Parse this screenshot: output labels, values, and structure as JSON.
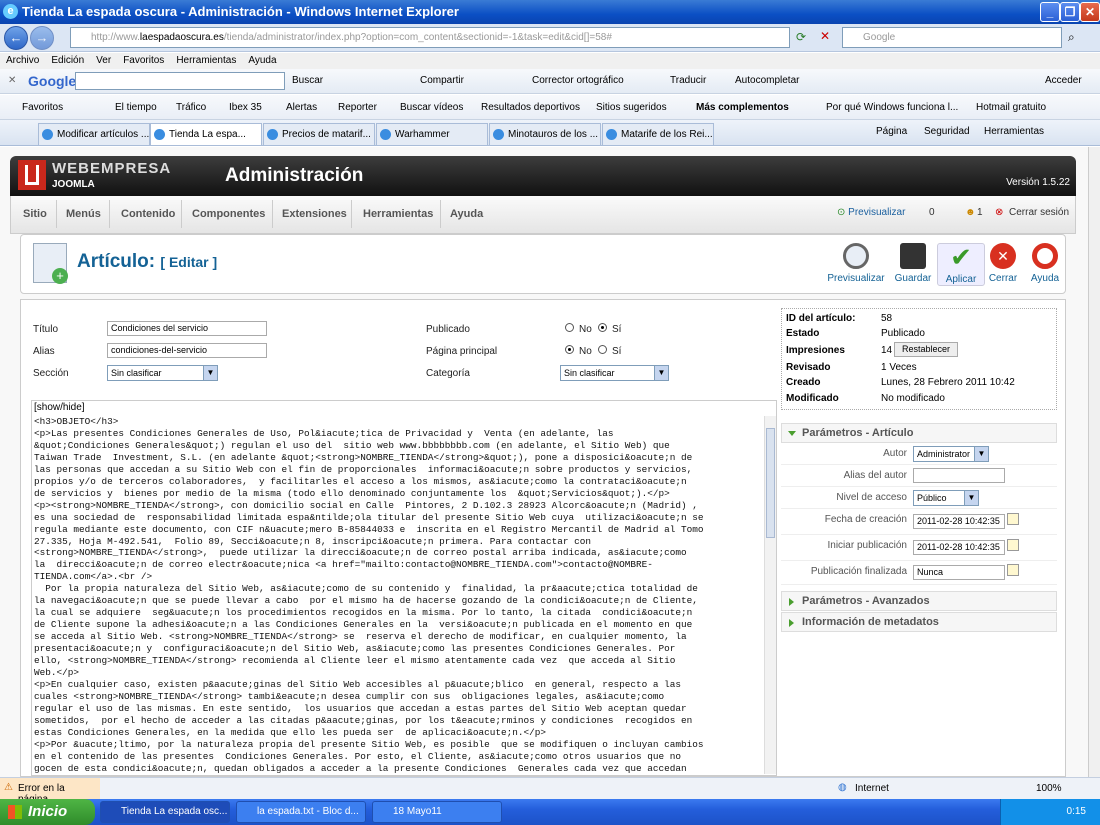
{
  "window": {
    "title": "Tienda La espada oscura - Administración - Windows Internet Explorer"
  },
  "address": {
    "url_prefix": "http://www.",
    "url_host": "laespadaoscura.es",
    "url_rest": "/tienda/administrator/index.php?option=com_content&sectionid=-1&task=edit&cid[]=58#",
    "search_placeholder": "Google"
  },
  "menu": [
    "Archivo",
    "Edición",
    "Ver",
    "Favoritos",
    "Herramientas",
    "Ayuda"
  ],
  "gtool": {
    "logo": "Google",
    "buscar": "Buscar",
    "compartir": "Compartir",
    "corrector": "Corrector ortográfico",
    "traducir": "Traducir",
    "autocompletar": "Autocompletar",
    "acceder": "Acceder"
  },
  "favorites": [
    "Favoritos",
    "El tiempo",
    "Tráfico",
    "Ibex 35",
    "Alertas",
    "Reporter",
    "Buscar vídeos",
    "Resultados deportivos",
    "Sitios sugeridos",
    "Más complementos",
    "Por qué Windows funciona l...",
    "Hotmail gratuito"
  ],
  "tabs": [
    "Modificar artículos ...",
    "Tienda La espa...",
    "Precios de matarif...",
    "Warhammer",
    "Minotauros de los ...",
    "Matarife de los Rei..."
  ],
  "tabtools": {
    "pagina": "Página",
    "seguridad": "Seguridad",
    "herramientas": "Herramientas"
  },
  "joomla": {
    "brand": "WEBEMPRESA",
    "sub": "JOOMLA",
    "title": "Administración",
    "version": "Versión 1.5.22"
  },
  "jmenu": [
    "Sitio",
    "Menús",
    "Contenido",
    "Componentes",
    "Extensiones",
    "Herramientas",
    "Ayuda"
  ],
  "jstatus": {
    "preview": "Previsualizar",
    "count1": "0",
    "count2": "1",
    "logout": "Cerrar sesión"
  },
  "page": {
    "title": "Artículo:",
    "action": "[ Editar ]"
  },
  "toolbar": {
    "preview": "Previsualizar",
    "save": "Guardar",
    "apply": "Aplicar",
    "close": "Cerrar",
    "help": "Ayuda"
  },
  "form": {
    "titulo_label": "Título",
    "titulo": "Condiciones del servicio",
    "alias_label": "Alias",
    "alias": "condiciones-del-servicio",
    "seccion_label": "Sección",
    "seccion": "Sin clasificar",
    "publicado_label": "Publicado",
    "principal_label": "Página principal",
    "categoria_label": "Categoría",
    "categoria": "Sin clasificar",
    "no": "No",
    "si": "Sí",
    "showhide": "[show/hide]"
  },
  "editor_text": "<h3>OBJETO</h3>\n<p>Las presentes Condiciones Generales de Uso, Pol&iacute;tica de Privacidad y  Venta (en adelante, las\n&quot;Condiciones Generales&quot;) regulan el uso del  sitio web www.bbbbbbbb.com (en adelante, el Sitio Web) que\nTaiwan Trade  Investment, S.L. (en adelante &quot;<strong>NOMBRE_TIENDA</strong>&quot;), pone a disposici&oacute;n de\nlas personas que accedan a su Sitio Web con el fin de proporcionales  informaci&oacute;n sobre productos y servicios,\npropios y/o de terceros colaboradores,  y facilitarles el acceso a los mismos, as&iacute;como la contrataci&oacute;n\nde servicios y  bienes por medio de la misma (todo ello denominado conjuntamente los  &quot;Servicios&quot;).</p>\n<p><strong>NOMBRE_TIENDA</strong>, con domicilio social en Calle  Pintores, 2 D.102.3 28923 Alcorc&oacute;n (Madrid) ,\nes una sociedad de  responsabilidad limitada espa&ntilde;ola titular del presente Sitio Web cuya  utilizaci&oacute;n se\nregula mediante este documento, con CIF n&uacute;mero B-85844033 e  inscrita en el Registro Mercantil de Madrid al Tomo\n27.335, Hoja M-492.541,  Folio 89, Secci&oacute;n 8, inscripci&oacute;n primera. Para contactar con\n<strong>NOMBRE_TIENDA</strong>,  puede utilizar la direcci&oacute;n de correo postal arriba indicada, as&iacute;como\nla  direcci&oacute;n de correo electr&oacute;nica <a href=\"mailto:contacto@NOMBRE_TIENDA.com\">contacto@NOMBRE-\nTIENDA.com</a>.<br />\n  Por la propia naturaleza del Sitio Web, as&iacute;como de su contenido y  finalidad, la pr&aacute;ctica totalidad de\nla navegaci&oacute;n que se puede llevar a cabo  por el mismo ha de hacerse gozando de la condici&oacute;n de Cliente,\nla cual se adquiere  seg&uacute;n los procedimientos recogidos en la misma. Por lo tanto, la citada  condici&oacute;n\nde Cliente supone la adhesi&oacute;n a las Condiciones Generales en la  versi&oacute;n publicada en el momento en que\nse acceda al Sitio Web. <strong>NOMBRE_TIENDA</strong> se  reserva el derecho de modificar, en cualquier momento, la\npresentaci&oacute;n y  configuraci&oacute;n del Sitio Web, as&iacute;como las presentes Condiciones Generales. Por\nello, <strong>NOMBRE_TIENDA</strong> recomienda al Cliente leer el mismo atentamente cada vez  que acceda al Sitio\nWeb.</p>\n<p>En cualquier caso, existen p&aacute;ginas del Sitio Web accesibles al p&uacute;blico  en general, respecto a las\ncuales <strong>NOMBRE_TIENDA</strong> tambi&eacute;n desea cumplir con sus  obligaciones legales, as&iacute;como\nregular el uso de las mismas. En este sentido,  los usuarios que accedan a estas partes del Sitio Web aceptan quedar\nsometidos,  por el hecho de acceder a las citadas p&aacute;ginas, por los t&eacute;rminos y condiciones  recogidos en\nestas Condiciones Generales, en la medida que ello les pueda ser  de aplicaci&oacute;n.</p>\n<p>Por &uacute;ltimo, por la naturaleza propia del presente Sitio Web, es posible  que se modifiquen o incluyan cambios\nen el contenido de las presentes  Condiciones Generales. Por esto, el Cliente, as&iacute;como otros usuarios que no\ngocen de esta condici&oacute;n, quedan obligados a acceder a la presente Condiciones  Generales cada vez que accedan",
  "info": {
    "id_label": "ID del artículo:",
    "id": "58",
    "estado_label": "Estado",
    "estado": "Publicado",
    "impresiones_label": "Impresiones",
    "impresiones": "14",
    "reset": "Restablecer",
    "revisado_label": "Revisado",
    "revisado": "1 Veces",
    "creado_label": "Creado",
    "creado": "Lunes, 28 Febrero 2011 10:42",
    "modificado_label": "Modificado",
    "modificado": "No modificado"
  },
  "params": {
    "header": "Parámetros - Artículo",
    "autor_label": "Autor",
    "autor": "Administrator",
    "alias_autor_label": "Alias del autor",
    "acceso_label": "Nivel de acceso",
    "acceso": "Público",
    "creacion_label": "Fecha de creación",
    "creacion": "2011-02-28 10:42:35",
    "inicio_label": "Iniciar publicación",
    "inicio": "2011-02-28 10:42:35",
    "fin_label": "Publicación finalizada",
    "fin": "Nunca",
    "avanzados": "Parámetros - Avanzados",
    "metadatos": "Información de metadatos"
  },
  "status": {
    "error": "Error en la página.",
    "zone": "Internet",
    "zoom": "100%"
  },
  "taskbar": {
    "start": "Inicio",
    "t1": "Tienda La espada osc...",
    "t2": "la espada.txt - Bloc d...",
    "t3": "18 Mayo11",
    "time": "0:15"
  }
}
